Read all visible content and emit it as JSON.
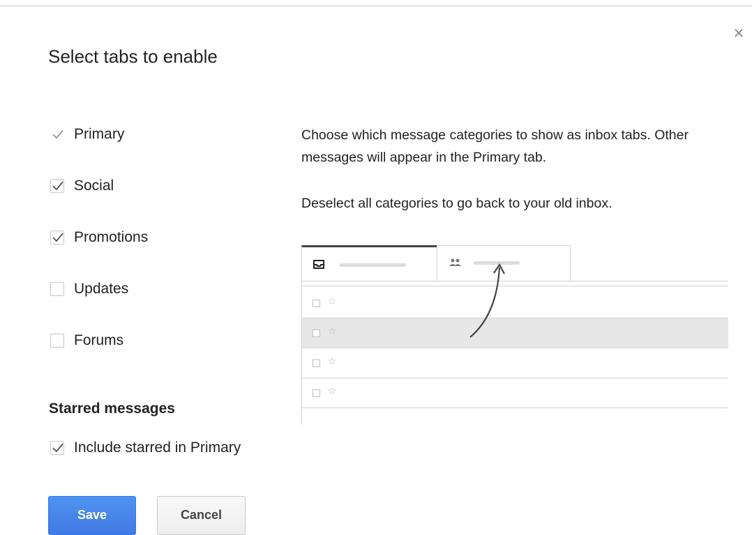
{
  "dialog": {
    "title": "Select tabs to enable",
    "close_glyph": "×"
  },
  "categories": [
    {
      "label": "Primary",
      "checked": true,
      "disabled": true
    },
    {
      "label": "Social",
      "checked": true,
      "disabled": false
    },
    {
      "label": "Promotions",
      "checked": true,
      "disabled": false
    },
    {
      "label": "Updates",
      "checked": false,
      "disabled": false
    },
    {
      "label": "Forums",
      "checked": false,
      "disabled": false
    }
  ],
  "starred": {
    "heading": "Starred messages",
    "label": "Include starred in Primary",
    "checked": true
  },
  "buttons": {
    "save": "Save",
    "cancel": "Cancel"
  },
  "help": {
    "line1": "Choose which message categories to show as inbox tabs. Other messages will appear in the Primary tab.",
    "line2": "Deselect all categories to go back to your old inbox."
  },
  "illustration": {
    "tabs": [
      {
        "icon": "inbox-icon"
      },
      {
        "icon": "people-icon"
      }
    ],
    "rows": [
      {
        "shaded": false
      },
      {
        "shaded": true
      },
      {
        "shaded": false
      },
      {
        "shaded": false
      }
    ]
  },
  "colors": {
    "save_button": "#4a86e8",
    "cancel_button": "#f5f5f5",
    "row_shade": "#e7e7e7"
  }
}
